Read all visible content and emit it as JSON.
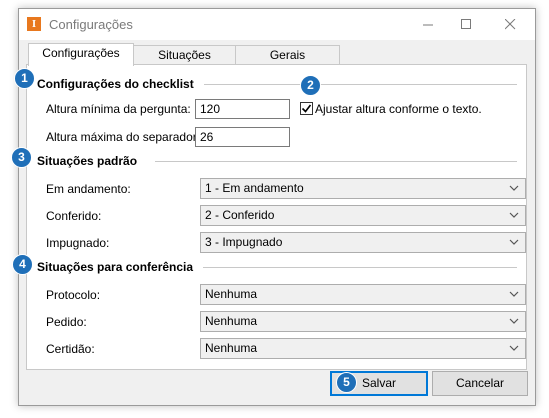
{
  "window": {
    "title": "Configurações",
    "app_icon_letter": "I"
  },
  "tabs": [
    {
      "label": "Configurações",
      "active": true
    },
    {
      "label": "Situações",
      "active": false
    },
    {
      "label": "Gerais",
      "active": false
    }
  ],
  "checklist": {
    "heading": "Configurações do checklist",
    "min_height_label": "Altura mínima da pergunta:",
    "min_height_value": "120",
    "max_height_label": "Altura máxima do separador:",
    "max_height_value": "26",
    "adjust_label": "Ajustar altura conforme o texto.",
    "adjust_checked": true
  },
  "default_situations": {
    "heading": "Situações padrão",
    "rows": [
      {
        "label": "Em andamento:",
        "value": "1 - Em andamento"
      },
      {
        "label": "Conferido:",
        "value": "2 - Conferido"
      },
      {
        "label": "Impugnado:",
        "value": "3 - Impugnado"
      }
    ]
  },
  "conference_situations": {
    "heading": "Situações para conferência",
    "rows": [
      {
        "label": "Protocolo:",
        "value": "Nenhuma"
      },
      {
        "label": "Pedido:",
        "value": "Nenhuma"
      },
      {
        "label": "Certidão:",
        "value": "Nenhuma"
      }
    ]
  },
  "buttons": {
    "save": "Salvar",
    "cancel": "Cancelar"
  },
  "badges": [
    "1",
    "2",
    "3",
    "4",
    "5"
  ],
  "colors": {
    "badge": "#1f6fb8",
    "app_icon": "#e8781e",
    "primary_border": "#0078d7"
  }
}
